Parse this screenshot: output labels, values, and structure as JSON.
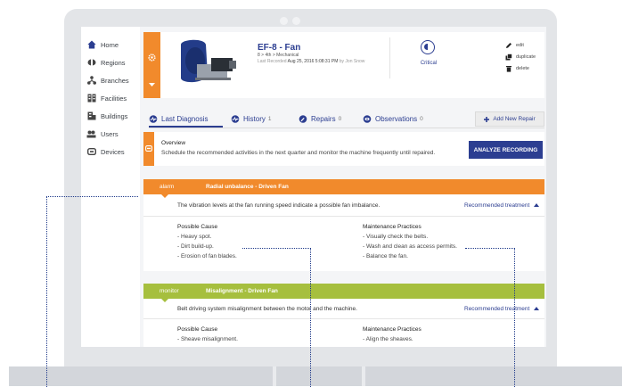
{
  "sidebar": {
    "items": [
      {
        "label": "Home",
        "icon": "home-icon"
      },
      {
        "label": "Regions",
        "icon": "regions-icon"
      },
      {
        "label": "Branches",
        "icon": "branches-icon"
      },
      {
        "label": "Facilities",
        "icon": "facilities-icon"
      },
      {
        "label": "Buildings",
        "icon": "buildings-icon"
      },
      {
        "label": "Users",
        "icon": "users-icon"
      },
      {
        "label": "Devices",
        "icon": "devices-icon"
      }
    ]
  },
  "asset": {
    "title": "EF-8 - Fan",
    "path": "8 > 4th > Mechanical",
    "recorded_label": "Last Recorded",
    "recorded_value": "Aug 25, 2016 5:08:31 PM",
    "recorded_by": "by Jon Snow",
    "criticality": "Critical",
    "actions": [
      "edit",
      "duplicate",
      "delete"
    ]
  },
  "tabs": [
    {
      "label": "Last Diagnosis",
      "count": ""
    },
    {
      "label": "History",
      "count": "1"
    },
    {
      "label": "Repairs",
      "count": "0"
    },
    {
      "label": "Observations",
      "count": "0"
    }
  ],
  "add_repair_label": "Add New Repair",
  "overview": {
    "title": "Overview",
    "text": "Schedule the recommended activities in the next quarter and monitor the machine frequently until repaired.",
    "button": "ANALYZE RECORDING"
  },
  "diagnoses": [
    {
      "level": "alarm",
      "title": "Radial unbalance - Driven Fan",
      "description": "The vibration levels at the fan running speed indicate a possible fan imbalance.",
      "treatment_label": "Recommended treatment",
      "cause_title": "Possible Cause",
      "causes": [
        "- Heavy spot.",
        "- Dirt build-up.",
        "- Erosion of fan blades."
      ],
      "practice_title": "Maintenance Practices",
      "practices": [
        "- Visually check the belts.",
        "- Wash and clean as access permits.",
        "- Balance the fan."
      ]
    },
    {
      "level": "monitor",
      "title": "Misalignment - Driven Fan",
      "description": "Belt driving system misalignment between the motor and the machine.",
      "treatment_label": "Recommended treatment",
      "cause_title": "Possible Cause",
      "causes": [
        "- Sheave misalignment."
      ],
      "practice_title": "Maintenance Practices",
      "practices": [
        "- Align the sheaves."
      ]
    }
  ],
  "colors": {
    "brand_blue": "#2c3e91",
    "alarm": "#f18a2c",
    "monitor": "#a6bf3e",
    "annotation": "#1f3a8a"
  }
}
